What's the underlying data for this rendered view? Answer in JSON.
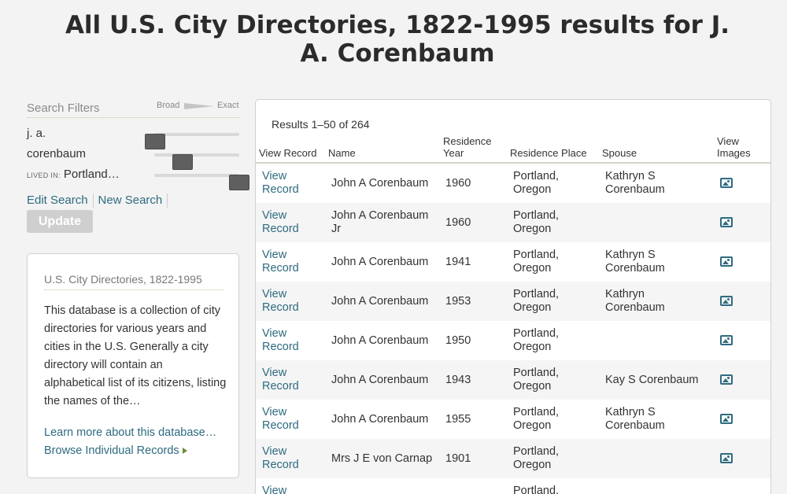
{
  "page": {
    "title": "All U.S. City Directories, 1822-1995 results for J. A. Corenbaum"
  },
  "filters": {
    "title": "Search Filters",
    "scale_broad": "Broad",
    "scale_exact": "Exact",
    "items": [
      {
        "label": "j. a.",
        "prefix": "",
        "slider_level": 0.0
      },
      {
        "label": "corenbaum",
        "prefix": "",
        "slider_level": 0.35
      },
      {
        "label": "Portland…",
        "prefix": "LIVED IN:",
        "slider_level": 1.0
      }
    ],
    "edit_search": "Edit Search",
    "new_search": "New Search",
    "update": "Update"
  },
  "database": {
    "title": "U.S. City Directories, 1822-1995",
    "description": "This database is a collection of city directories for various years and cities in the U.S. Generally a city directory will contain an alphabetical list of its citizens, listing the names of the…",
    "learn_more": "Learn more about this database…",
    "browse": "Browse Individual Records"
  },
  "results": {
    "count": "Results 1–50 of 264",
    "headers": {
      "view_record": "View Record",
      "name": "Name",
      "residence_year": "Residence Year",
      "residence_place": "Residence Place",
      "spouse": "Spouse",
      "view_images": "View Images"
    },
    "rows": [
      {
        "link": "View Record",
        "name": "John A Corenbaum",
        "year": "1960",
        "place": "Portland, Oregon",
        "spouse": "Kathryn S Corenbaum"
      },
      {
        "link": "View Record",
        "name": "John A Corenbaum Jr",
        "year": "1960",
        "place": "Portland, Oregon",
        "spouse": ""
      },
      {
        "link": "View Record",
        "name": "John A Corenbaum",
        "year": "1941",
        "place": "Portland, Oregon",
        "spouse": "Kathryn S Corenbaum"
      },
      {
        "link": "View Record",
        "name": "John A Corenbaum",
        "year": "1953",
        "place": "Portland, Oregon",
        "spouse": "Kathryn Corenbaum"
      },
      {
        "link": "View Record",
        "name": "John A Corenbaum",
        "year": "1950",
        "place": "Portland, Oregon",
        "spouse": ""
      },
      {
        "link": "View Record",
        "name": "John A Corenbaum",
        "year": "1943",
        "place": "Portland, Oregon",
        "spouse": "Kay S Corenbaum"
      },
      {
        "link": "View Record",
        "name": "John A Corenbaum",
        "year": "1955",
        "place": "Portland, Oregon",
        "spouse": "Kathryn S Corenbaum"
      },
      {
        "link": "View Record",
        "name": "Mrs J E von Carnap",
        "year": "1901",
        "place": "Portland, Oregon",
        "spouse": ""
      },
      {
        "link": "View Record",
        "name": "",
        "year": "",
        "place": "Portland,",
        "spouse": ""
      }
    ]
  },
  "colors": {
    "link": "#2e6b80",
    "slider_handle": "#5f5f5f",
    "update_button": "#cfcfcf",
    "browse_arrow": "#6b8b3d"
  }
}
